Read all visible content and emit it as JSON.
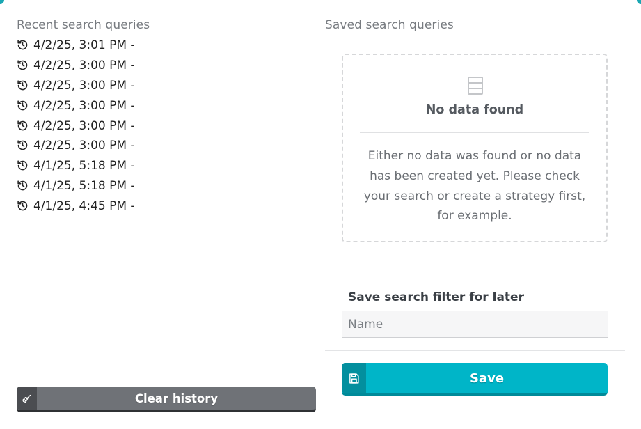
{
  "recent": {
    "title": "Recent search queries",
    "items": [
      {
        "label": "4/2/25, 3:01 PM -"
      },
      {
        "label": "4/2/25, 3:00 PM -"
      },
      {
        "label": "4/2/25, 3:00 PM -"
      },
      {
        "label": "4/2/25, 3:00 PM -"
      },
      {
        "label": "4/2/25, 3:00 PM -"
      },
      {
        "label": "4/2/25, 3:00 PM -"
      },
      {
        "label": "4/1/25, 5:18 PM -"
      },
      {
        "label": "4/1/25, 5:18 PM -"
      },
      {
        "label": "4/1/25, 4:45 PM -"
      }
    ],
    "clear_button": {
      "label": "Clear history",
      "icon": "broom-icon"
    }
  },
  "saved": {
    "title": "Saved search queries",
    "empty": {
      "icon": "database-icon",
      "heading": "No data found",
      "message": "Either no data was found or no data has been created yet. Please check your search or create a strategy first, for example."
    },
    "form": {
      "label": "Save search filter for later",
      "name_placeholder": "Name",
      "name_value": "",
      "save_button": {
        "label": "Save",
        "icon": "floppy-disk-icon"
      }
    }
  },
  "colors": {
    "accent": "#00b5c8",
    "accent_dark": "#038f9e",
    "clear_button": "#6f7277"
  }
}
